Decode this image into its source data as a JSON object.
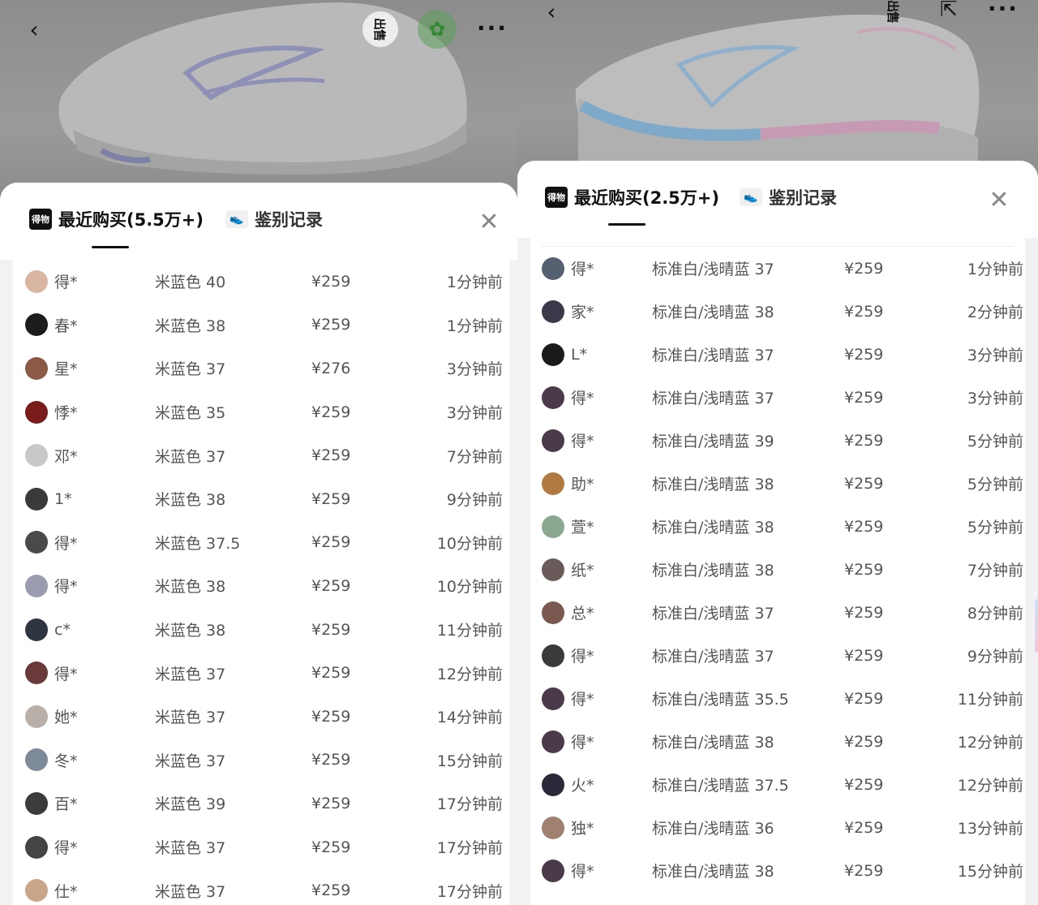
{
  "left": {
    "hero": {
      "back_icon": "‹",
      "sell_label": "出售",
      "wechat_icon": "wechat-icon",
      "more_icon": "···"
    },
    "sheet": {
      "tab_recent": {
        "logo_text": "得物",
        "label": "最近购买(5.5万+)"
      },
      "tab_auth": {
        "label": "鉴别记录"
      },
      "close_icon": "✕"
    },
    "rows": [
      {
        "user": "得*",
        "spec": "米蓝色 40",
        "price": "¥259",
        "time": "1分钟前",
        "avatar_color": "#d8b6a2"
      },
      {
        "user": "春*",
        "spec": "米蓝色 38",
        "price": "¥259",
        "time": "1分钟前",
        "avatar_color": "#1c1c1c"
      },
      {
        "user": "星*",
        "spec": "米蓝色 37",
        "price": "¥276",
        "time": "3分钟前",
        "avatar_color": "#8a5a46"
      },
      {
        "user": "悸*",
        "spec": "米蓝色 35",
        "price": "¥259",
        "time": "3分钟前",
        "avatar_color": "#7a1c1c"
      },
      {
        "user": "邓*",
        "spec": "米蓝色 37",
        "price": "¥259",
        "time": "7分钟前",
        "avatar_color": "#c8c8c8"
      },
      {
        "user": "1*",
        "spec": "米蓝色 38",
        "price": "¥259",
        "time": "9分钟前",
        "avatar_color": "#3a3a3a"
      },
      {
        "user": "得*",
        "spec": "米蓝色 37.5",
        "price": "¥259",
        "time": "10分钟前",
        "avatar_color": "#4a4a4a"
      },
      {
        "user": "得*",
        "spec": "米蓝色 38",
        "price": "¥259",
        "time": "10分钟前",
        "avatar_color": "#9b9bb0"
      },
      {
        "user": "c*",
        "spec": "米蓝色 38",
        "price": "¥259",
        "time": "11分钟前",
        "avatar_color": "#2e3440"
      },
      {
        "user": "得*",
        "spec": "米蓝色 37",
        "price": "¥259",
        "time": "12分钟前",
        "avatar_color": "#6a3a3a"
      },
      {
        "user": "她*",
        "spec": "米蓝色 37",
        "price": "¥259",
        "time": "14分钟前",
        "avatar_color": "#b8b0a8"
      },
      {
        "user": "冬*",
        "spec": "米蓝色 37",
        "price": "¥259",
        "time": "15分钟前",
        "avatar_color": "#7d8a99"
      },
      {
        "user": "百*",
        "spec": "米蓝色 39",
        "price": "¥259",
        "time": "17分钟前",
        "avatar_color": "#3b3b3b"
      },
      {
        "user": "得*",
        "spec": "米蓝色 37",
        "price": "¥259",
        "time": "17分钟前",
        "avatar_color": "#444444"
      },
      {
        "user": "仕*",
        "spec": "米蓝色 37",
        "price": "¥259",
        "time": "17分钟前",
        "avatar_color": "#c9a58a"
      }
    ]
  },
  "right": {
    "hero": {
      "back_icon": "‹",
      "sell_label": "出售",
      "share_icon": "⇱",
      "more_icon": "···"
    },
    "sheet": {
      "tab_recent": {
        "logo_text": "得物",
        "label": "最近购买(2.5万+)"
      },
      "tab_auth": {
        "label": "鉴别记录"
      },
      "close_icon": "✕"
    },
    "rows": [
      {
        "user": "得*",
        "spec": "标准白/浅晴蓝 37",
        "price": "¥259",
        "time": "1分钟前",
        "avatar_color": "#556070"
      },
      {
        "user": "家*",
        "spec": "标准白/浅晴蓝 38",
        "price": "¥259",
        "time": "2分钟前",
        "avatar_color": "#3a3a4a"
      },
      {
        "user": "L*",
        "spec": "标准白/浅晴蓝 37",
        "price": "¥259",
        "time": "3分钟前",
        "avatar_color": "#1a1a1a"
      },
      {
        "user": "得*",
        "spec": "标准白/浅晴蓝 37",
        "price": "¥259",
        "time": "3分钟前",
        "avatar_color": "#4a3a4a"
      },
      {
        "user": "得*",
        "spec": "标准白/浅晴蓝 39",
        "price": "¥259",
        "time": "5分钟前",
        "avatar_color": "#4a3a4a"
      },
      {
        "user": "助*",
        "spec": "标准白/浅晴蓝 38",
        "price": "¥259",
        "time": "5分钟前",
        "avatar_color": "#b07a40"
      },
      {
        "user": "萱*",
        "spec": "标准白/浅晴蓝 38",
        "price": "¥259",
        "time": "5分钟前",
        "avatar_color": "#8aa890"
      },
      {
        "user": "纸*",
        "spec": "标准白/浅晴蓝 38",
        "price": "¥259",
        "time": "7分钟前",
        "avatar_color": "#6a5a5a"
      },
      {
        "user": "总*",
        "spec": "标准白/浅晴蓝 37",
        "price": "¥259",
        "time": "8分钟前",
        "avatar_color": "#7a5a50"
      },
      {
        "user": "得*",
        "spec": "标准白/浅晴蓝 37",
        "price": "¥259",
        "time": "9分钟前",
        "avatar_color": "#3a3a3a"
      },
      {
        "user": "得*",
        "spec": "标准白/浅晴蓝 35.5",
        "price": "¥259",
        "time": "11分钟前",
        "avatar_color": "#4a3a4a"
      },
      {
        "user": "得*",
        "spec": "标准白/浅晴蓝 38",
        "price": "¥259",
        "time": "12分钟前",
        "avatar_color": "#4a3a4a"
      },
      {
        "user": "火*",
        "spec": "标准白/浅晴蓝 37.5",
        "price": "¥259",
        "time": "12分钟前",
        "avatar_color": "#2a2a3a"
      },
      {
        "user": "独*",
        "spec": "标准白/浅晴蓝 36",
        "price": "¥259",
        "time": "13分钟前",
        "avatar_color": "#a08070"
      },
      {
        "user": "得*",
        "spec": "标准白/浅晴蓝 38",
        "price": "¥259",
        "time": "15分钟前",
        "avatar_color": "#4a3a4a"
      }
    ]
  }
}
